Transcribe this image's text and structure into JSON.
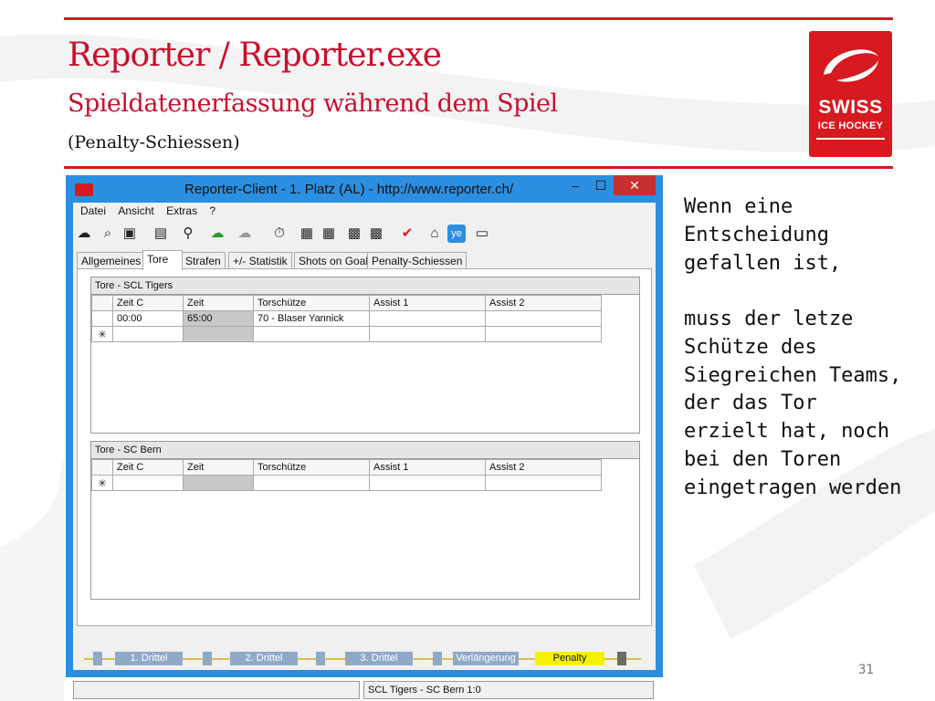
{
  "slide": {
    "title": "Reporter / Reporter.exe",
    "subtitle": "Spieldatenerfassung während dem Spiel",
    "note": "(Penalty-Schiessen)",
    "page_number": "31",
    "accent": "#c8102e"
  },
  "logo": {
    "line1": "SWISS",
    "line2": "ICE HOCKEY"
  },
  "window": {
    "caption": "Reporter-Client  -  1. Platz (AL)  -  http://www.reporter.ch/",
    "min": "–",
    "max": "☐",
    "close": "✕",
    "menu": [
      "Datei",
      "Ansicht",
      "Extras",
      "?"
    ],
    "tabs": [
      "Allgemeines",
      "Tore",
      "Strafen",
      "+/- Statistik",
      "Shots on Goal",
      "Penalty-Schiessen"
    ],
    "active_tab": "Tore",
    "group1": {
      "title": "Tore - SCL Tigers",
      "headers": [
        "Zeit C",
        "Zeit",
        "Torschütze",
        "Assist 1",
        "Assist 2"
      ],
      "row": [
        "00:00",
        "65:00",
        "70 - Blaser Yannick",
        "",
        ""
      ],
      "new_row_marker": "✳"
    },
    "group2": {
      "title": "Tore - SC Bern",
      "headers": [
        "Zeit C",
        "Zeit",
        "Torschütze",
        "Assist 1",
        "Assist 2"
      ],
      "new_row_marker": "✳"
    },
    "periods": [
      "1. Drittel",
      "2. Drittel",
      "3. Drittel",
      "Verlängerung",
      "Penalty"
    ],
    "active_period": "Penalty",
    "status": "SCL Tigers - SC Bern 1:0"
  },
  "side_text": {
    "p1": "Wenn eine Entscheidung gefallen ist,",
    "p2": "muss der letze Schütze des Siegreichen Teams, der das Tor erzielt hat, noch bei den Toren eingetragen werden"
  }
}
